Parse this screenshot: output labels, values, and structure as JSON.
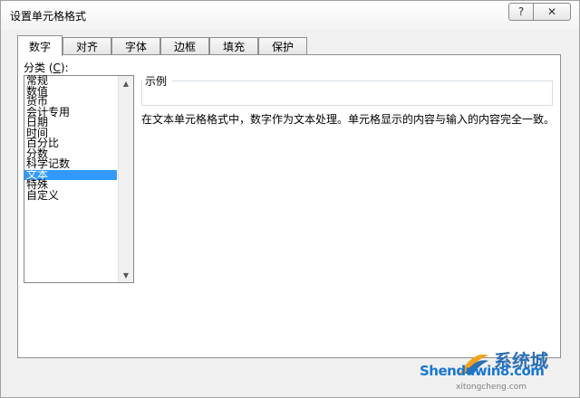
{
  "dialog": {
    "title": "设置单元格格式",
    "help_label": "?",
    "close_label": "✕"
  },
  "tabs": [
    {
      "label": "数字",
      "active": true
    },
    {
      "label": "对齐"
    },
    {
      "label": "字体"
    },
    {
      "label": "边框"
    },
    {
      "label": "填充"
    },
    {
      "label": "保护"
    }
  ],
  "category": {
    "label_prefix": "分类 (",
    "label_key": "C",
    "label_suffix": "):",
    "items": [
      "常规",
      "数值",
      "货币",
      "会计专用",
      "日期",
      "时间",
      "百分比",
      "分数",
      "科学记数",
      "文本",
      "特殊",
      "自定义"
    ],
    "selected": "文本"
  },
  "sample": {
    "label": "示例",
    "value": ""
  },
  "description": "在文本单元格格式中，数字作为文本处理。单元格显示的内容与输入的内容完全一致。",
  "watermark": {
    "brand": "Shenduwin8.com",
    "chinese": "系统城",
    "sub": "xitongcheng.com"
  },
  "colors": {
    "selection": "#3399ff",
    "watermark_blue": "#1a76d2"
  },
  "icons": {
    "help": "question-mark-icon",
    "close": "close-icon",
    "scroll_up": "triangle-up-icon",
    "scroll_down": "triangle-down-icon"
  }
}
